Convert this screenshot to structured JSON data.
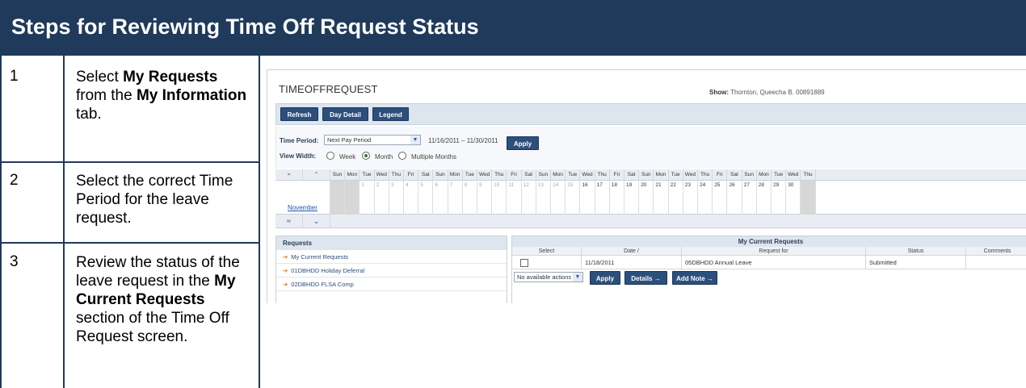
{
  "title": "Steps for Reviewing Time Off Request Status",
  "steps": [
    {
      "num": "1",
      "parts": [
        [
          "Select ",
          false
        ],
        [
          "My Requests",
          true
        ],
        [
          " from the ",
          false
        ],
        [
          "My Information",
          true
        ],
        [
          " tab.",
          false
        ]
      ]
    },
    {
      "num": "2",
      "parts": [
        [
          "Select the correct Time Period for the leave request.",
          false
        ]
      ]
    },
    {
      "num": "3",
      "parts": [
        [
          "Review the status of the leave request in the ",
          false
        ],
        [
          "My Current Requests",
          true
        ],
        [
          " section of the Time Off Request screen.",
          false
        ]
      ]
    }
  ],
  "screen": {
    "app_title": "TIMEOFFREQUEST",
    "show_label": "Show:",
    "show_value": "Thornton, Queecha B.   00891889",
    "toolbar": {
      "refresh": "Refresh",
      "day_detail": "Day Detail",
      "legend": "Legend"
    },
    "time_period_label": "Time Period:",
    "time_period_value": "Next Pay Period",
    "date_range": "11/16/2011 – 11/30/2011",
    "apply": "Apply",
    "view_width_label": "View Width:",
    "view_options": [
      "Week",
      "Month",
      "Multiple Months"
    ],
    "selected_view": "Month",
    "month_link": "November",
    "weekdays": [
      "Sun",
      "Mon",
      "Tue",
      "Wed",
      "Thu",
      "Fri",
      "Sat",
      "Sun",
      "Mon",
      "Tue",
      "Wed",
      "Thu",
      "Fri",
      "Sat",
      "Sun",
      "Mon",
      "Tue",
      "Wed",
      "Thu",
      "Fri",
      "Sat",
      "Sun",
      "Mon",
      "Tue",
      "Wed",
      "Thu",
      "Fri",
      "Sat",
      "Sun",
      "Mon",
      "Tue",
      "Wed",
      "Thu"
    ],
    "days": [
      "",
      "",
      "1",
      "2",
      "3",
      "4",
      "5",
      "6",
      "7",
      "8",
      "9",
      "10",
      "11",
      "12",
      "13",
      "14",
      "15",
      "16",
      "17",
      "18",
      "19",
      "20",
      "21",
      "22",
      "23",
      "24",
      "25",
      "26",
      "27",
      "28",
      "29",
      "30",
      ""
    ],
    "requests_header": "Requests",
    "request_items": [
      "My Current Requests",
      "01DBHDD Holiday Deferral",
      "02DBHDD FLSA Comp"
    ],
    "current_requests_header": "My Current Requests",
    "columns": [
      "Select",
      "Date  /",
      "Request for",
      "Status",
      "Comments"
    ],
    "row": {
      "date": "11/18/2011",
      "request_for": "05DBHDD Annual Leave",
      "status": "Submitted",
      "comments": ""
    },
    "actions_select": "No available actions",
    "details_button": "Details →",
    "add_note_button": "Add Note →"
  }
}
